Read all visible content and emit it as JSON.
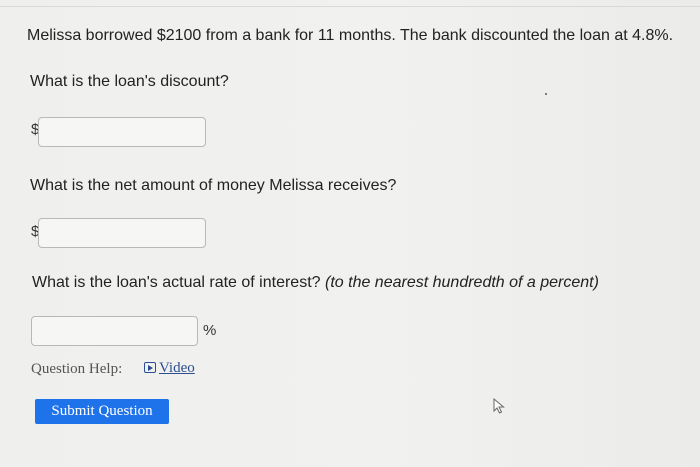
{
  "question": {
    "prompt": "Melissa borrowed $2100 from a bank for 11 months. The bank discounted the loan at 4.8%.",
    "part1": "What is the loan's discount?",
    "part2": "What is the net amount of money Melissa receives?",
    "part3_main": "What is the loan's actual rate of interest?",
    "part3_hint": "(to the nearest hundredth of a percent)"
  },
  "answers": {
    "currency_symbol_1": "$",
    "currency_symbol_2": "$",
    "percent_symbol": "%",
    "discount_value": "",
    "net_amount_value": "",
    "actual_rate_value": ""
  },
  "help": {
    "label": "Question Help:",
    "video_label": "Video",
    "video_icon": "play-video-icon"
  },
  "actions": {
    "submit_label": "Submit Question"
  },
  "colors": {
    "page_background": "#efefed",
    "text": "#222222",
    "link": "#2d4f92",
    "primary_button": "#1f73ea",
    "input_border": "#b8b8b5"
  }
}
